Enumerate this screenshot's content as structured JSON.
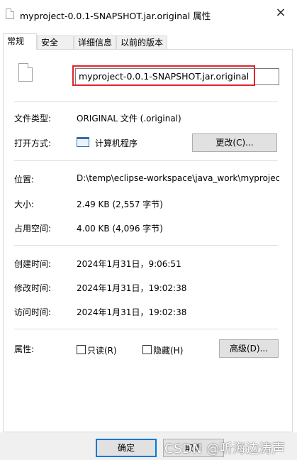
{
  "window": {
    "title": "myproject-0.0.1-SNAPSHOT.jar.original 属性",
    "close_glyph": "×"
  },
  "tabs": [
    {
      "label": "常规",
      "active": true
    },
    {
      "label": "安全",
      "active": false
    },
    {
      "label": "详细信息",
      "active": false
    },
    {
      "label": "以前的版本",
      "active": false
    }
  ],
  "general": {
    "file_name": "myproject-0.0.1-SNAPSHOT.jar.original",
    "file_type_label": "文件类型:",
    "file_type_value": "ORIGINAL 文件 (.original)",
    "open_with_label": "打开方式:",
    "open_with_value": "计算机程序",
    "change_button": "更改(C)...",
    "location_label": "位置:",
    "location_value": "D:\\temp\\eclipse-workspace\\java_work\\myproject\\",
    "size_label": "大小:",
    "size_value": "2.49 KB (2,557 字节)",
    "size_on_disk_label": "占用空间:",
    "size_on_disk_value": "4.00 KB (4,096 字节)",
    "created_label": "创建时间:",
    "created_value": "2024年1月31日，9:06:51",
    "modified_label": "修改时间:",
    "modified_value": "2024年1月31日，19:02:38",
    "accessed_label": "访问时间:",
    "accessed_value": "2024年1月31日，19:02:38",
    "attributes_label": "属性:",
    "readonly_label": "只读(R)",
    "hidden_label": "隐藏(H)",
    "advanced_button": "高级(D)..."
  },
  "footer": {
    "ok_button": "确定",
    "cancel_button": "取消",
    "watermark": "CSDN @听海边涛声"
  },
  "colors": {
    "highlight_border": "#e0242c",
    "primary_button_border": "#0078d7"
  }
}
